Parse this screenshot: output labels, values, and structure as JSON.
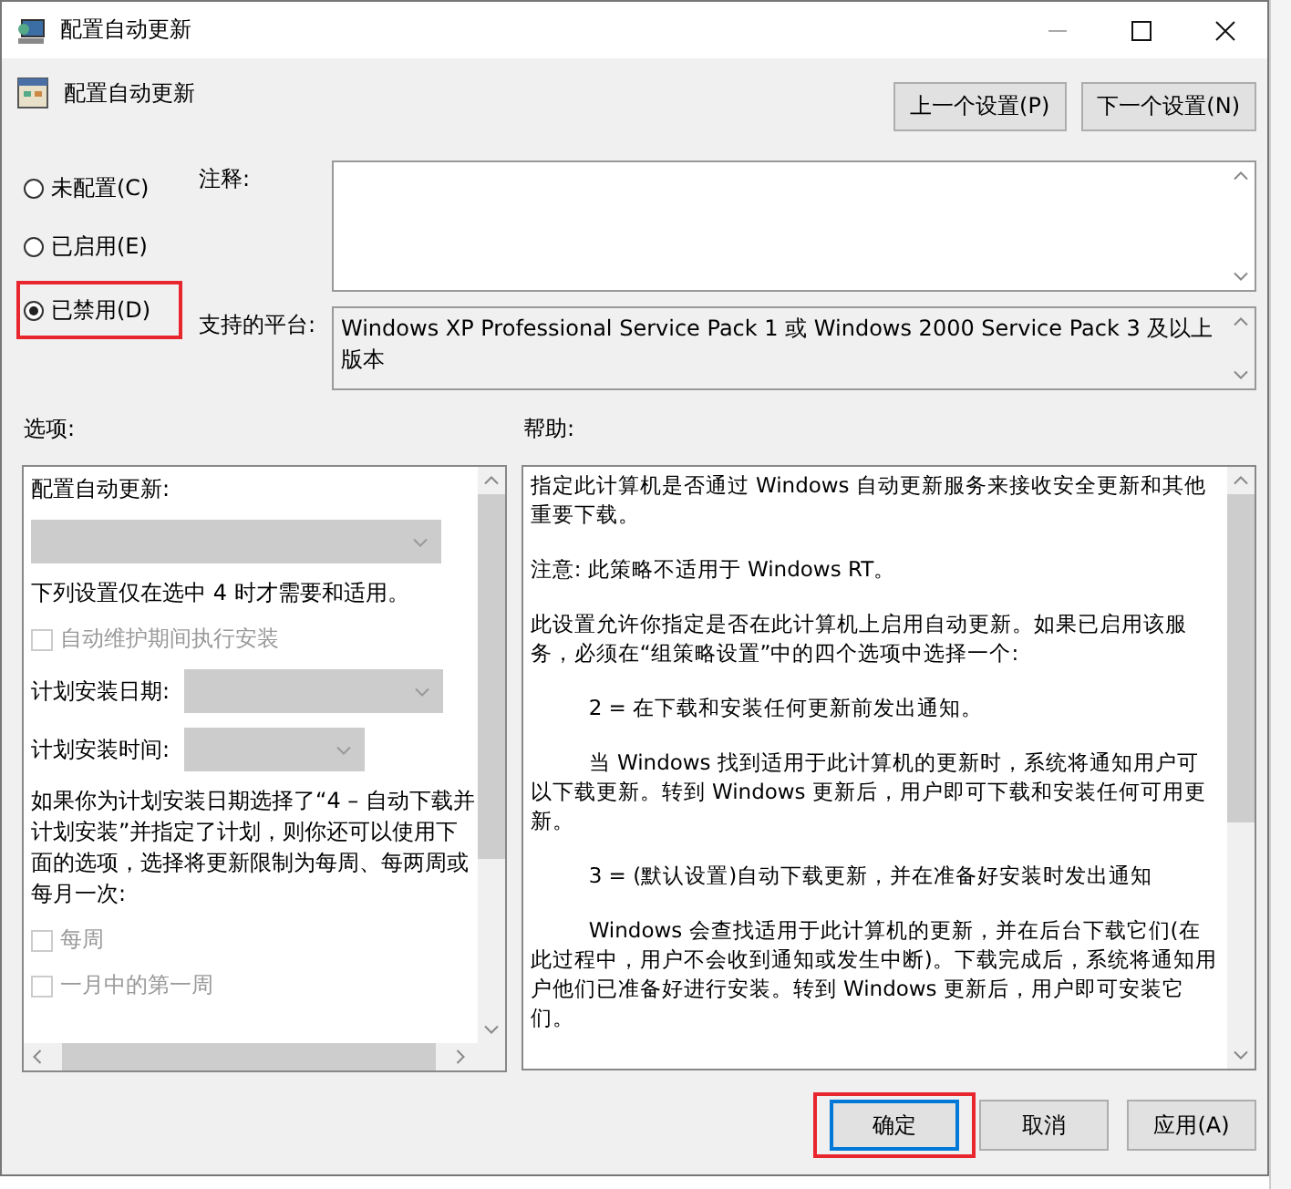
{
  "window": {
    "title": "配置自动更新"
  },
  "header": {
    "title": "配置自动更新",
    "buttons": [
      "上一个设置(P)",
      "下一个设置(N)"
    ]
  },
  "radios": [
    {
      "label": "未配置(C)",
      "selected": false
    },
    {
      "label": "已启用(E)",
      "selected": false
    },
    {
      "label": "已禁用(D)",
      "selected": true
    }
  ],
  "comment": {
    "label": "注释:"
  },
  "platform": {
    "label": "支持的平台:",
    "value": "Windows XP Professional Service Pack 1 或 Windows 2000 Service Pack 3 及以上版本"
  },
  "options": {
    "label": "选项:",
    "items": [
      {
        "kind": "label",
        "text": "配置自动更新:"
      },
      {
        "kind": "dropdown",
        "disabled": true
      },
      {
        "kind": "label",
        "text": "下列设置仅在选中 4 时才需要和适用。"
      },
      {
        "kind": "checkbox",
        "text": "自动维护期间执行安装",
        "checked": false,
        "disabled": true
      },
      {
        "kind": "labeled_dropdown",
        "text": "计划安装日期:",
        "disabled": true
      },
      {
        "kind": "labeled_dropdown",
        "text": "计划安装时间:",
        "disabled": true
      },
      {
        "kind": "label",
        "text": "如果你为计划安装日期选择了“4 – 自动下载并计划安装”并指定了计划，则你还可以使用下面的选项，选择将更新限制为每周、每两周或每月一次:"
      },
      {
        "kind": "checkbox",
        "text": "每周",
        "checked": false,
        "disabled": true
      },
      {
        "kind": "checkbox",
        "text": "一月中的第一周",
        "checked": false,
        "disabled": true
      }
    ]
  },
  "help": {
    "label": "帮助:",
    "paragraphs": [
      {
        "indent": false,
        "text": "指定此计算机是否通过 Windows 自动更新服务来接收安全更新和其他重要下载。"
      },
      {
        "indent": false,
        "text": "注意: 此策略不适用于 Windows RT。"
      },
      {
        "indent": false,
        "text": "此设置允许你指定是否在此计算机上启用自动更新。如果已启用该服务，必须在“组策略设置”中的四个选项中选择一个:"
      },
      {
        "indent": true,
        "text": "2 = 在下载和安装任何更新前发出通知。"
      },
      {
        "indent": true,
        "text": "当 Windows 找到适用于此计算机的更新时，系统将通知用户可以下载更新。转到 Windows 更新后，用户即可下载和安装任何可用更新。"
      },
      {
        "indent": true,
        "text": "3 = (默认设置)自动下载更新，并在准备好安装时发出通知"
      },
      {
        "indent": true,
        "text": "Windows 会查找适用于此计算机的更新，并在后台下载它们(在此过程中，用户不会收到通知或发生中断)。下载完成后，系统将通知用户他们已准备好进行安装。转到 Windows 更新后，用户即可安装它们。"
      }
    ]
  },
  "buttons": [
    {
      "label": "确定",
      "default": true
    },
    {
      "label": "取消",
      "default": false
    },
    {
      "label": "应用(A)",
      "default": false
    }
  ]
}
